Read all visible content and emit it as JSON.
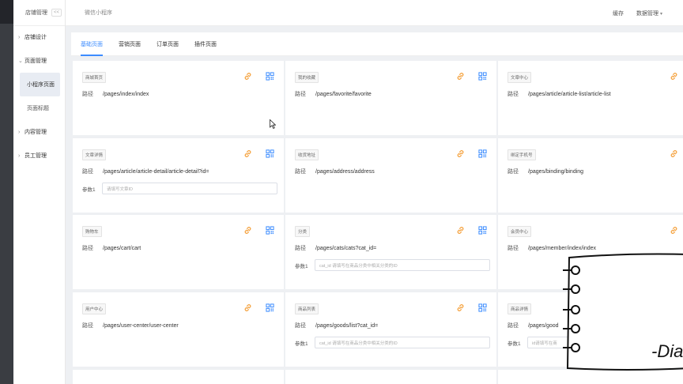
{
  "sidebar": {
    "title": "店铺管理",
    "collapse": "<<",
    "groups": [
      {
        "label": "店铺设计",
        "arrow": "›"
      },
      {
        "label": "页面管理",
        "arrow": "⌄"
      },
      {
        "label": "内容管理",
        "arrow": "›"
      },
      {
        "label": "员工管理",
        "arrow": "›"
      }
    ],
    "subitems": [
      "小程序页面",
      "页面标题"
    ]
  },
  "topbar": {
    "crumb": "微信小程序",
    "cache": "缓存",
    "admin": "数据管理"
  },
  "tabs": [
    "基础页面",
    "营销页面",
    "订单页面",
    "插件页面"
  ],
  "path_label": "路径",
  "param_label": "参数1",
  "cards": [
    {
      "tag": "商城首页",
      "path": "/pages/index/index"
    },
    {
      "tag": "我的收藏",
      "path": "/pages/favorite/favorite"
    },
    {
      "tag": "文章中心",
      "path": "/pages/article/article-list/article-list"
    },
    {
      "tag": "文章详情",
      "path": "/pages/article/article-detail/article-detail?id=",
      "placeholder": "请填写文章ID"
    },
    {
      "tag": "收货地址",
      "path": "/pages/address/address"
    },
    {
      "tag": "绑定手机号",
      "path": "/pages/binding/binding"
    },
    {
      "tag": "购物车",
      "path": "/pages/cart/cart"
    },
    {
      "tag": "分类",
      "path": "/pages/cats/cats?cat_id=",
      "placeholder": "cat_id 请填写在商品分类中相关分类的ID"
    },
    {
      "tag": "会员中心",
      "path": "/pages/member/index/index"
    },
    {
      "tag": "用户中心",
      "path": "/pages/user-center/user-center"
    },
    {
      "tag": "商品列表",
      "path": "/pages/goods/list?cat_id=",
      "placeholder": "cat_id 请填写在商品分类中相关分类的ID"
    },
    {
      "tag": "商品详情",
      "path": "/pages/good",
      "placeholder": "id请填写在商"
    }
  ],
  "notebook_text": "-Dia",
  "colors": {
    "accent": "#3c8cff",
    "link_icon": "#f5a13c",
    "qr_icon": "#3c8cff"
  }
}
